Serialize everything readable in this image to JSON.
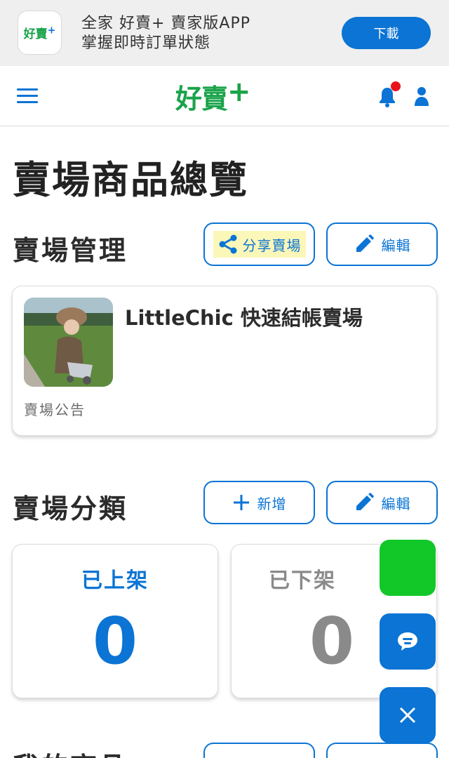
{
  "banner": {
    "icon_text": "好賣",
    "icon_plus": "+",
    "line1": "全家 好賣+ 賣家版APP",
    "line2": "掌握即時訂單狀態",
    "download_label": "下載"
  },
  "header": {
    "logo_text": "好賣",
    "logo_plus": "+",
    "has_notification": true
  },
  "page": {
    "title": "賣場商品總覽"
  },
  "store_section": {
    "title": "賣場管理",
    "share_label": "分享賣場",
    "edit_label": "編輯",
    "store_name": "LittleChic 快速結帳賣場",
    "notice_label": "賣場公告"
  },
  "category_section": {
    "title": "賣場分類",
    "add_label": "新增",
    "edit_label": "編輯"
  },
  "stats": [
    {
      "label": "已上架",
      "value": "0",
      "color": "#0b74d4"
    },
    {
      "label": "已下架",
      "value": "0",
      "color": "#8a8a8a"
    }
  ],
  "products_section": {
    "title": "我的商品"
  },
  "colors": {
    "accent": "#0b74d4",
    "brand_green": "#1aa34a",
    "fab_green": "#12c829",
    "notification": "#e8141b",
    "share_highlight": "#fbf7b9"
  }
}
